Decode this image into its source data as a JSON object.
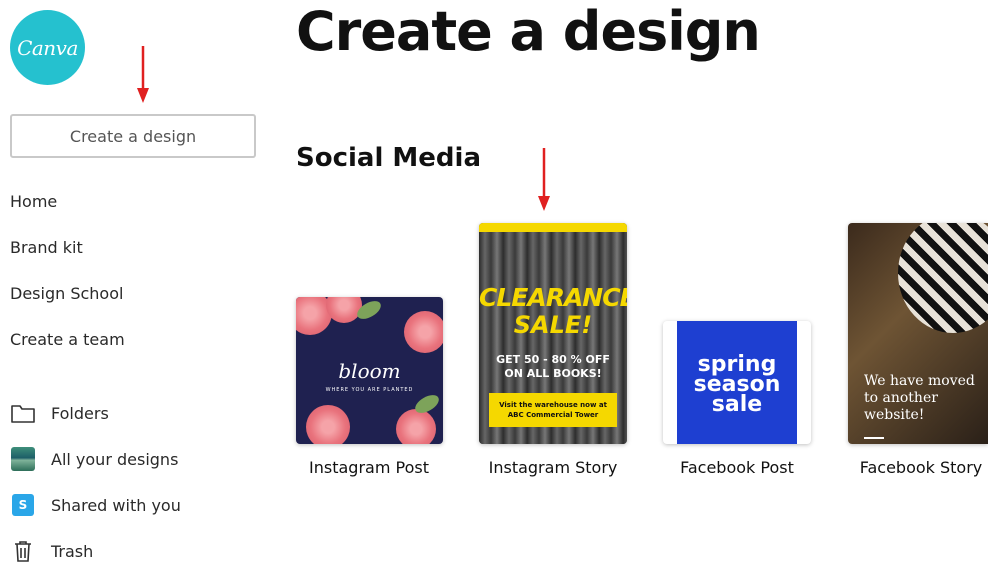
{
  "logo": {
    "text": "Canva",
    "color": "#25c1cf"
  },
  "sidebar": {
    "create_button": "Create a design",
    "nav": [
      "Home",
      "Brand kit",
      "Design School",
      "Create a team"
    ],
    "items": [
      {
        "label": "Folders",
        "icon": "folder-icon"
      },
      {
        "label": "All your designs",
        "icon": "designs-thumbnail-icon"
      },
      {
        "label": "Shared with you",
        "icon": "shared-icon",
        "badge": "S"
      },
      {
        "label": "Trash",
        "icon": "trash-icon"
      }
    ]
  },
  "main": {
    "title": "Create a design",
    "section": "Social Media",
    "cards": [
      {
        "label": "Instagram Post",
        "preview": {
          "word": "bloom",
          "sub": "WHERE YOU ARE PLANTED"
        }
      },
      {
        "label": "Instagram Story",
        "preview": {
          "line1": "CLEARANCE",
          "line2": "SALE!",
          "offer1": "GET 50 - 80 % OFF",
          "offer2": "ON ALL BOOKS!",
          "box1": "Visit the warehouse now at",
          "box2": "ABC Commercial Tower"
        }
      },
      {
        "label": "Facebook Post",
        "preview": {
          "w1": "spring",
          "w2": "season",
          "w3": "sale"
        }
      },
      {
        "label": "Facebook Story",
        "preview": {
          "l1": "We have moved",
          "l2": "to another",
          "l3": "website!"
        }
      }
    ]
  },
  "annotation_color": "#e02020"
}
